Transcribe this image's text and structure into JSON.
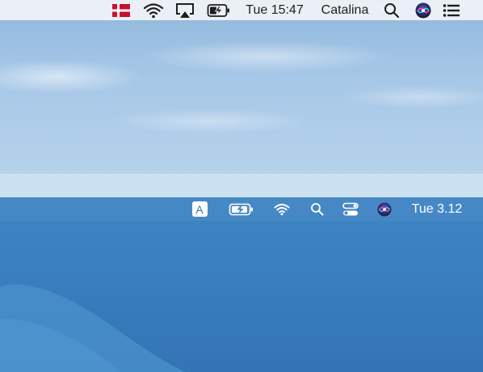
{
  "top_menubar": {
    "input_flag_icon": "denmark-flag-icon",
    "wifi_icon": "wifi-icon",
    "airplay_icon": "airplay-icon",
    "battery_icon": "battery-charging-icon",
    "clock": "Tue 15:47",
    "user_name": "Catalina",
    "spotlight_icon": "search-icon",
    "siri_icon": "siri-icon",
    "notification_icon": "notification-center-icon"
  },
  "bottom_menubar": {
    "input_source_letter": "A",
    "battery_icon": "battery-charging-icon",
    "wifi_icon": "wifi-icon",
    "spotlight_icon": "search-icon",
    "control_center_icon": "control-center-icon",
    "siri_icon": "siri-icon",
    "clock": "Tue 3.12"
  },
  "colors": {
    "flag_red": "#c8102e",
    "bigsur_blue": "#3a7fbf",
    "catalina_sky": "#a4c6e6"
  }
}
